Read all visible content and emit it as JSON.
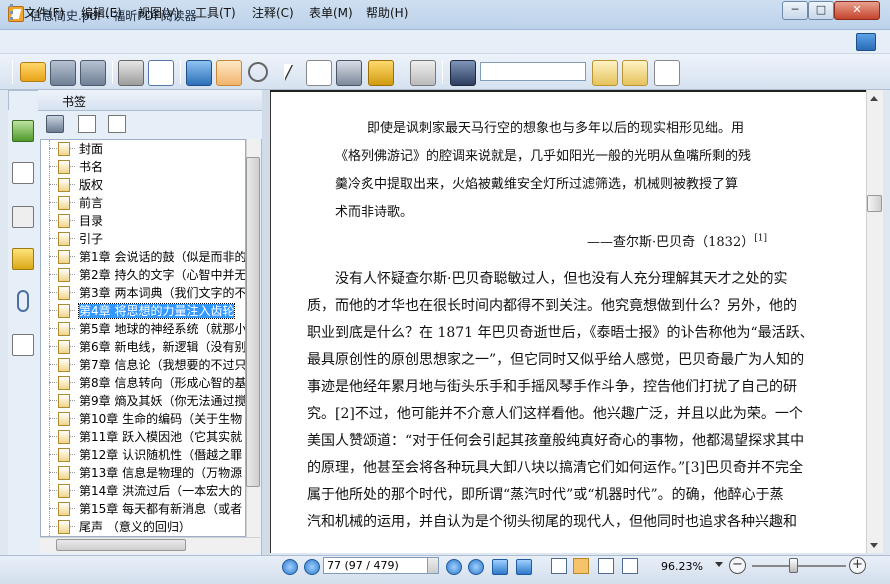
{
  "window": {
    "title": "信息简史.pdf - 福昕PDF阅读器",
    "minimize": "─",
    "maximize": "□",
    "close": "✕"
  },
  "menu": [
    "文件(F)",
    "编辑(E)",
    "视图(V)",
    "工具(T)",
    "注释(C)",
    "表单(M)",
    "帮助(H)"
  ],
  "search": {
    "value": ""
  },
  "sidebar": {
    "title": "书签",
    "bookmarks": [
      "封面",
      "书名",
      "版权",
      "前言",
      "目录",
      "引子",
      "第1章  会说话的鼓（似是而非的",
      "第2章  持久的文字（心智中并无",
      "第3章  两本词典（我们文字的不",
      "第4章  将思想的力量注入齿轮",
      "第5章  地球的神经系统（就那小",
      "第6章  新电线，新逻辑（没有别",
      "第7章  信息论（我想要的不过只",
      "第8章  信息转向（形成心智的基",
      "第9章  熵及其妖（你无法通过搅",
      "第10章  生命的编码（关于生物",
      "第11章  跃入模因池（它其实就",
      "第12章  认识随机性（僭越之罪",
      "第13章  信息是物理的（万物源",
      "第14章  洪流过后（一本宏大的",
      "第15章  每天都有新消息（或者",
      "尾声  （意义的回归）"
    ],
    "selected_index": 9
  },
  "document": {
    "epigraph": [
      "即使是讽刺家最天马行空的想象也与多年以后的现实相形见绌。用",
      "《格列佛游记》的腔调来说就是，几乎如阳光一般的光明从鱼嘴所剩的残",
      "羹冷炙中提取出来，火焰被戴维安全灯所过滤筛选，机械则被教授了算",
      "术而非诗歌。"
    ],
    "attribution": "——查尔斯·巴贝奇（1832）",
    "attribution_note": "[1]",
    "paragraph": [
      "没有人怀疑查尔斯·巴贝奇聪敏过人，但也没有人充分理解其天才之处的实",
      "质，而他的才华也在很长时间内都得不到关注。他究竟想做到什么？另外，他的",
      "职业到底是什么？在 1871 年巴贝奇逝世后，《泰晤士报》的讣告称他为“最活跃、",
      "最具原创性的原创思想家之一”，但它同时又似乎给人感觉，巴贝奇最广为人知的",
      "事迹是他经年累月地与街头乐手和手摇风琴手作斗争，控告他们打扰了自己的研",
      "究。[2]不过，他可能并不介意人们这样看他。他兴趣广泛，并且以此为荣。一个",
      "美国人赞颂道：“对于任何会引起其孩童般纯真好奇心的事物，他都渴望探求其中",
      "的原理，他甚至会将各种玩具大卸八块以搞清它们如何运作。”[3]巴贝奇并不完全",
      "属于他所处的那个时代，即所谓“蒸汽时代”或“机器时代”。的确，他醉心于蒸",
      "汽和机械的运用，并自认为是个彻头彻尾的现代人，但他同时也追求各种兴趣和"
    ]
  },
  "status": {
    "page": "77 (97 / 479)",
    "zoom": "96.23%",
    "zoom_out": "−",
    "zoom_in": "+"
  }
}
